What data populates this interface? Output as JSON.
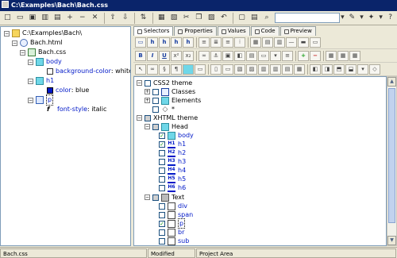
{
  "window": {
    "title": "C:\\Examples\\Bach\\Bach.css"
  },
  "toolbar": {
    "buttons": [
      "new",
      "open",
      "save",
      "close",
      "add",
      "remove",
      "cut-rule",
      "up",
      "down",
      "sort",
      "props",
      "props2",
      "copy",
      "paste",
      "cut",
      "undo",
      "view",
      "view2",
      "find",
      "color"
    ],
    "find_placeholder": ""
  },
  "left_tree": {
    "root": "C:\\Examples\\Bach\\",
    "html_file": "Bach.html",
    "css_file": "Bach.css",
    "rules": [
      {
        "selector": "body",
        "property": "background-color",
        "value": "white"
      },
      {
        "selector": "h1",
        "property": "color",
        "value": "blue"
      },
      {
        "selector": "p",
        "property": "font-style",
        "value": "italic"
      }
    ]
  },
  "tabs": [
    {
      "label": "Selectors",
      "active": true
    },
    {
      "label": "Properties",
      "active": false
    },
    {
      "label": "Values",
      "active": false
    },
    {
      "label": "Code",
      "active": false
    },
    {
      "label": "Preview",
      "active": false
    }
  ],
  "formatting": {
    "bold": "B",
    "italic": "I",
    "underline": "U"
  },
  "selectors_tree": {
    "css2_theme": "CSS2 theme",
    "classes": "Classes",
    "elements": "Elements",
    "star": "*",
    "xhtml_theme": "XHTML theme",
    "head": "Head",
    "head_items": [
      "body",
      "h1",
      "h2",
      "h3",
      "h4",
      "h5",
      "h6"
    ],
    "text": "Text",
    "text_items": [
      "div",
      "span",
      "p",
      "br",
      "sub"
    ]
  },
  "status": {
    "file": "Bach.css",
    "state": "Modified",
    "area": "Project Area"
  }
}
